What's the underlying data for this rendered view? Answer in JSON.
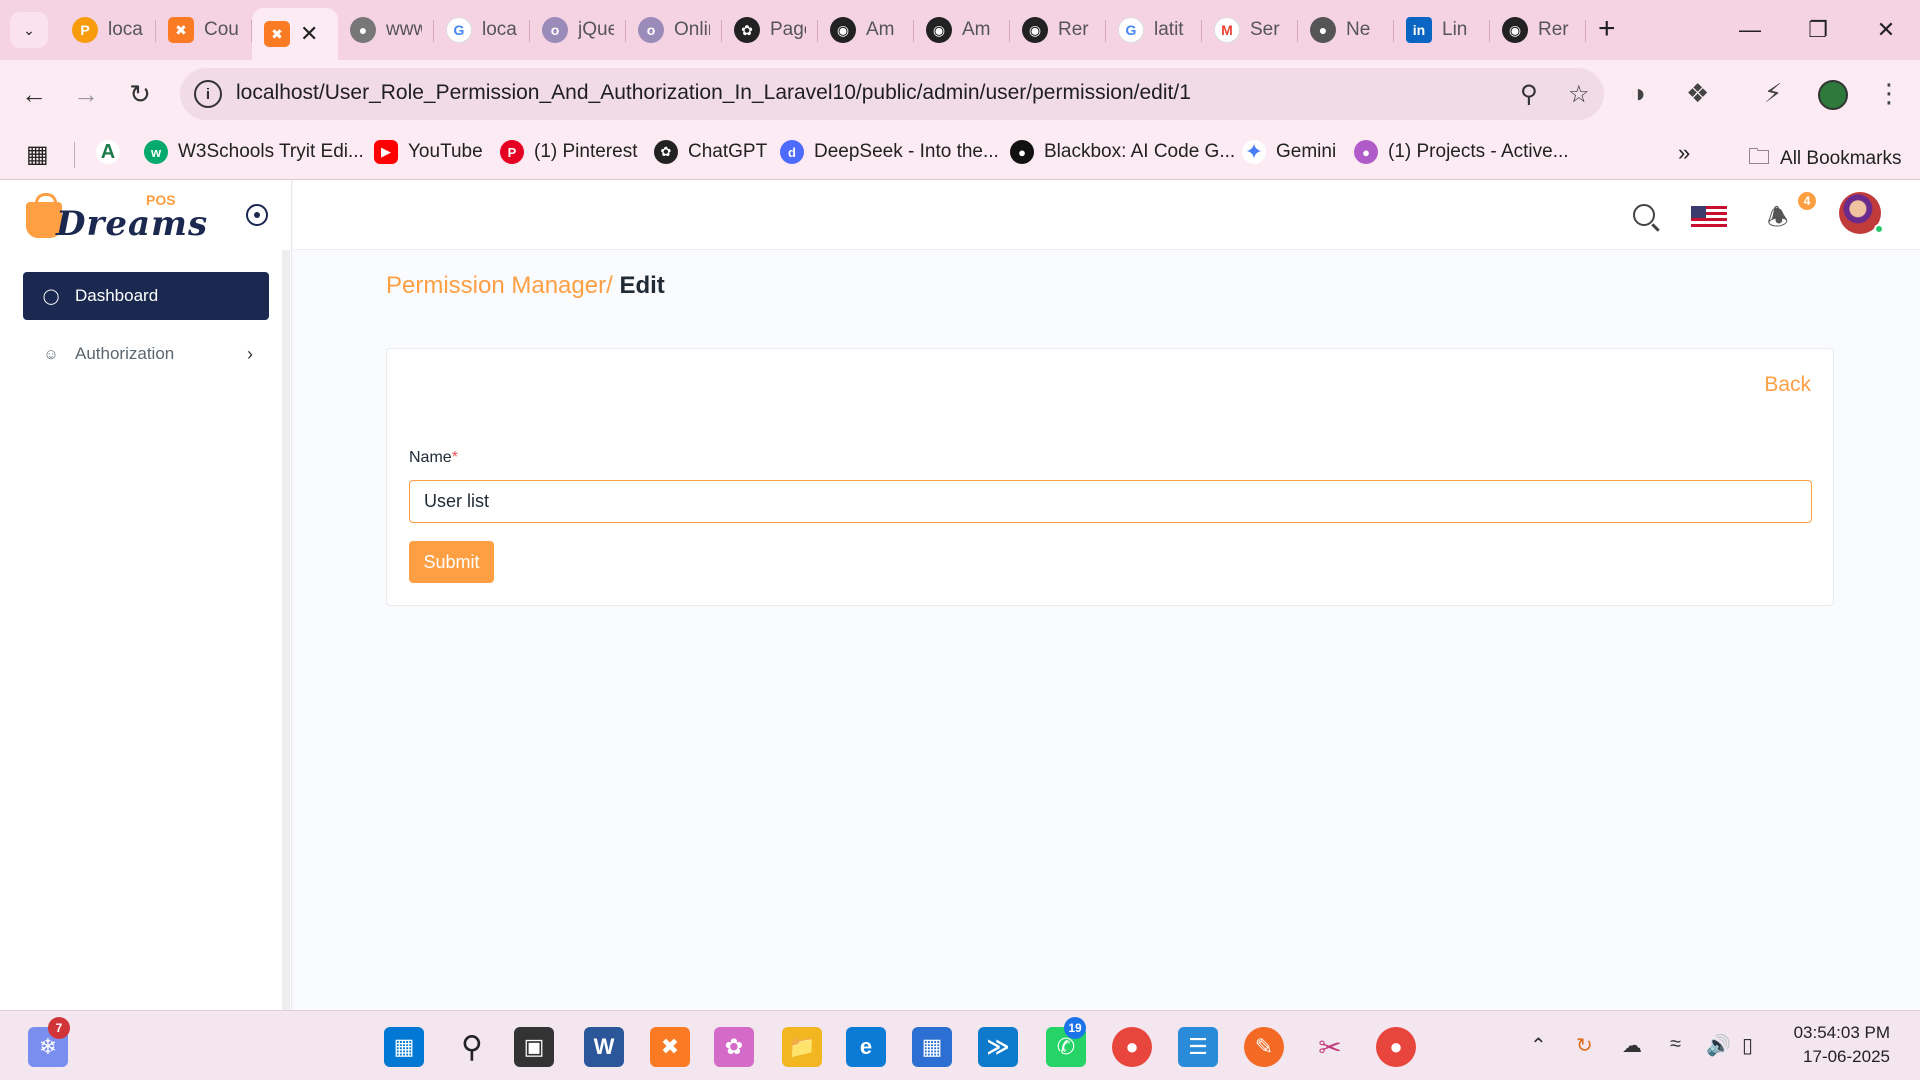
{
  "browser": {
    "tabs": [
      {
        "title": "localhost",
        "favicon": "pma-icon",
        "color": "#f89c0e"
      },
      {
        "title": "Coupons",
        "favicon": "xampp-icon",
        "color": "#fb7a24"
      },
      {
        "title": "",
        "favicon": "xampp-icon",
        "color": "#fb7a24",
        "active": true
      },
      {
        "title": "www",
        "favicon": "globe-icon",
        "color": "#777777"
      },
      {
        "title": "localhost",
        "favicon": "google-icon",
        "color": "#4285f4"
      },
      {
        "title": "jQuery",
        "favicon": "owl-icon",
        "color": "#9b8bb8"
      },
      {
        "title": "Online",
        "favicon": "owl-icon",
        "color": "#9b8bb8"
      },
      {
        "title": "Page",
        "favicon": "chatgpt-icon",
        "color": "#222222"
      },
      {
        "title": "Am",
        "favicon": "github-icon",
        "color": "#222222"
      },
      {
        "title": "Am",
        "favicon": "github-icon",
        "color": "#222222"
      },
      {
        "title": "Rer",
        "favicon": "github-icon",
        "color": "#222222"
      },
      {
        "title": "latit",
        "favicon": "google-icon",
        "color": "#4285f4"
      },
      {
        "title": "Ser",
        "favicon": "gmail-icon",
        "color": "#ea4335"
      },
      {
        "title": "Ne",
        "favicon": "globe-icon",
        "color": "#555555"
      },
      {
        "title": "Lin",
        "favicon": "linkedin-icon",
        "color": "#0a66c2"
      },
      {
        "title": "Rer",
        "favicon": "github-icon",
        "color": "#222222"
      }
    ],
    "url_host": "localhost",
    "url_path": "/User_Role_Permission_And_Authorization_In_Laravel10/public/admin/user/permission/edit/1",
    "bookmarks": [
      {
        "label": "",
        "icon": "apps-grid-icon"
      },
      {
        "label": "",
        "icon": "a-logo-icon",
        "color": "#1e7b4a"
      },
      {
        "label": "W3Schools Tryit Edi...",
        "icon": "w3schools-icon",
        "color": "#04aa6d"
      },
      {
        "label": "YouTube",
        "icon": "youtube-icon",
        "color": "#ff0000"
      },
      {
        "label": "(1) Pinterest",
        "icon": "pinterest-icon",
        "color": "#e60023"
      },
      {
        "label": "ChatGPT",
        "icon": "chatgpt-icon",
        "color": "#222222"
      },
      {
        "label": "DeepSeek - Into the...",
        "icon": "deepseek-icon",
        "color": "#4d6bfe"
      },
      {
        "label": "Blackbox: AI Code G...",
        "icon": "blackbox-icon",
        "color": "#111111"
      },
      {
        "label": "Gemini",
        "icon": "gemini-icon",
        "color": "#4a7cf5"
      },
      {
        "label": "(1) Projects - Active...",
        "icon": "projects-icon",
        "color": "#b05cc8"
      }
    ],
    "all_bookmarks": "All Bookmarks"
  },
  "app": {
    "logo_word": "Dreams",
    "logo_pos": "POS",
    "menu": {
      "dashboard": "Dashboard",
      "authorization": "Authorization"
    },
    "notification_count": "4",
    "accent": "#fe9f43",
    "navy": "#1b2850"
  },
  "page": {
    "breadcrumb_link": "Permission Manager/",
    "breadcrumb_current": "Edit",
    "back": "Back",
    "name_label": "Name",
    "required_mark": "*",
    "name_value": "User list",
    "submit": "Submit"
  },
  "taskbar": {
    "widgets_badge": "7",
    "whatsapp_badge": "19",
    "time": "03:54:03 PM",
    "date": "17-06-2025"
  }
}
